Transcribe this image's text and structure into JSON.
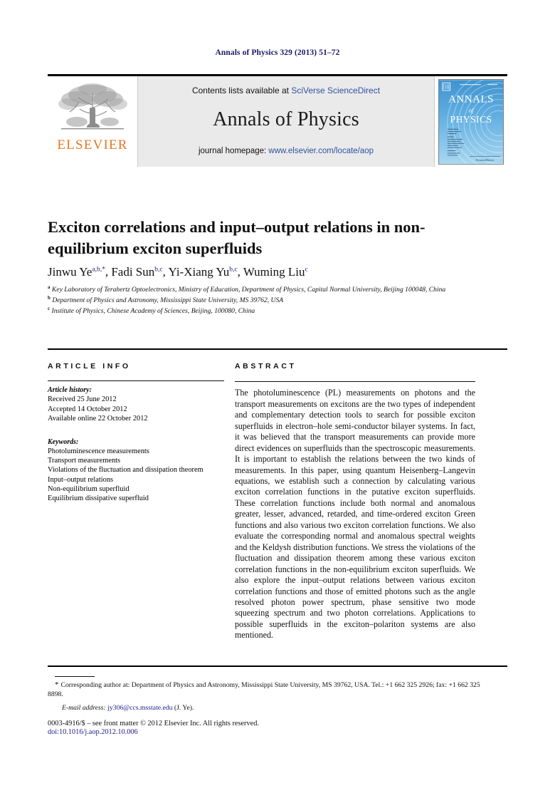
{
  "running_head": "Annals of Physics 329 (2013) 51–72",
  "masthead": {
    "publisher_logo_name": "ELSEVIER",
    "contents_prefix": "Contents lists available at ",
    "contents_link": "SciVerse ScienceDirect",
    "journal_name": "Annals of Physics",
    "homepage_prefix": "journal homepage: ",
    "homepage_link": "www.elsevier.com/locate/aop",
    "cover": {
      "line1": "ANNALS",
      "line2": "of",
      "line3": "PHYSICS"
    }
  },
  "article": {
    "title": "Exciton correlations and input–output relations in non-equilibrium exciton superfluids",
    "authors": [
      {
        "name": "Jinwu Ye",
        "sup": "a,b,*"
      },
      {
        "name": "Fadi Sun",
        "sup": "b,c"
      },
      {
        "name": "Yi-Xiang Yu",
        "sup": "b,c"
      },
      {
        "name": "Wuming Liu",
        "sup": "c"
      }
    ],
    "affiliations": [
      {
        "mark": "a",
        "text": "Key Laboratory of Terahertz Optoelectronics, Ministry of Education, Department of Physics, Capital Normal University, Beijing 100048, China"
      },
      {
        "mark": "b",
        "text": "Department of Physics and Astronomy, Mississippi State University, MS 39762, USA"
      },
      {
        "mark": "c",
        "text": "Institute of Physics, Chinese Academy of Sciences, Beijing, 100080, China"
      }
    ]
  },
  "article_info": {
    "heading": "ARTICLE INFO",
    "history_label": "Article history:",
    "history": [
      "Received 25 June 2012",
      "Accepted 14 October 2012",
      "Available online 22 October 2012"
    ],
    "keywords_label": "Keywords:",
    "keywords": [
      "Photoluminescence measurements",
      "Transport measurements",
      "Violations of the fluctuation and dissipation theorem",
      "Input–output relations",
      "Non-equilibrium superfluid",
      "Equilibrium dissipative superfluid"
    ]
  },
  "abstract": {
    "heading": "ABSTRACT",
    "text": "The photoluminescence (PL) measurements on photons and the transport measurements on excitons are the two types of independent and complementary detection tools to search for possible exciton superfluids in electron–hole semi-conductor bilayer systems. In fact, it was believed that the transport measurements can provide more direct evidences on superfluids than the spectroscopic measurements. It is important to establish the relations between the two kinds of measurements. In this paper, using quantum Heisenberg–Langevin equations, we establish such a connection by calculating various exciton correlation functions in the putative exciton superfluids. These correlation functions include both normal and anomalous greater, lesser, advanced, retarded, and time-ordered exciton Green functions and also various two exciton correlation functions. We also evaluate the corresponding normal and anomalous spectral weights and the Keldysh distribution functions. We stress the violations of the fluctuation and dissipation theorem among these various exciton correlation functions in the non-equilibrium exciton superfluids. We also explore the input–output relations between various exciton correlation functions and those of emitted photons such as the angle resolved photon power spectrum, phase sensitive two mode squeezing spectrum and two photon correlations. Applications to possible superfluids in the exciton–polariton systems are also mentioned."
  },
  "footnotes": {
    "corresponding_star": "*",
    "corresponding_text": "Corresponding author at: Department of Physics and Astronomy, Mississippi State University, MS 39762, USA. Tel.: +1 662 325 2926; fax: +1 662 325 8898.",
    "email_label": "E-mail address:",
    "email_address": "jy306@ccs.msstate.edu",
    "email_owner": "(J. Ye)."
  },
  "footer": {
    "copyright": "0003-4916/$ – see front matter © 2012 Elsevier Inc. All rights reserved.",
    "doi": "doi:10.1016/j.aop.2012.10.006"
  },
  "colors": {
    "link_blue": "#2f51a3",
    "running_head_navy": "#1a1a66",
    "elsevier_orange": "#E87722",
    "cover_blue": "#4a9fd8",
    "panel_grey": "#eaeaea"
  }
}
